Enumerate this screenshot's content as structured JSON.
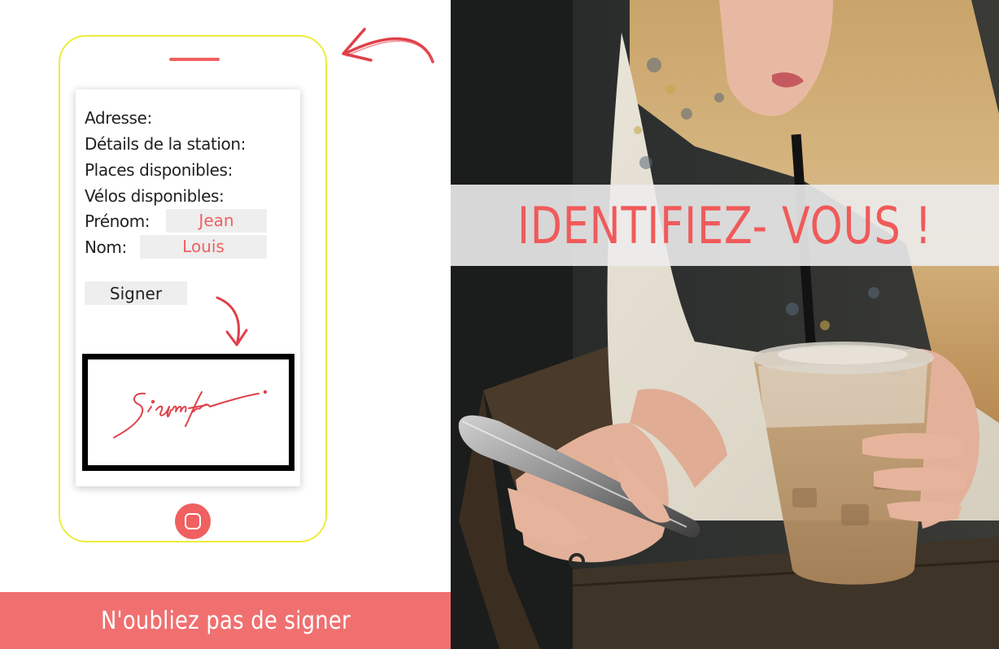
{
  "form": {
    "address_label": "Adresse:",
    "station_details_label": "Détails de la station:",
    "available_places_label": "Places disponibles:",
    "available_bikes_label": "Vélos disponibles:",
    "first_name_label": "Prénom:",
    "first_name_value": "Jean",
    "last_name_label": "Nom:",
    "last_name_value": "Louis",
    "sign_button_label": "Signer",
    "signature_text": "Signature"
  },
  "reminder": {
    "text": "N'oubliez pas de signer"
  },
  "hero": {
    "heading": "IDENTIFIEZ- VOUS !"
  },
  "colors": {
    "accent": "#f06060",
    "phone_outline": "#ecec3c",
    "banner": "#f07070",
    "heading": "#f05a5a"
  }
}
